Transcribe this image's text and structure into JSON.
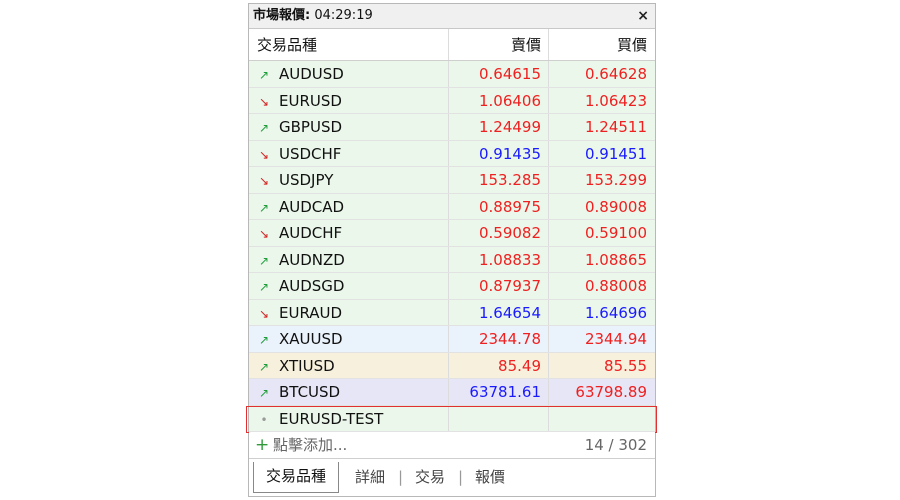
{
  "window": {
    "title_label": "市場報價:",
    "time": "04:29:19",
    "close_glyph": "×"
  },
  "columns": {
    "symbol": "交易品種",
    "bid": "賣價",
    "ask": "買價"
  },
  "rows": [
    {
      "symbol": "AUDUSD",
      "bid": "0.64615",
      "ask": "0.64628",
      "dir": "up",
      "arrow": "↗",
      "bg": "#eaf7ea",
      "bid_color": "red",
      "ask_color": "red"
    },
    {
      "symbol": "EURUSD",
      "bid": "1.06406",
      "ask": "1.06423",
      "dir": "down",
      "arrow": "↘",
      "bg": "#eaf7ea",
      "bid_color": "red",
      "ask_color": "red"
    },
    {
      "symbol": "GBPUSD",
      "bid": "1.24499",
      "ask": "1.24511",
      "dir": "up",
      "arrow": "↗",
      "bg": "#eaf7ea",
      "bid_color": "red",
      "ask_color": "red"
    },
    {
      "symbol": "USDCHF",
      "bid": "0.91435",
      "ask": "0.91451",
      "dir": "down",
      "arrow": "↘",
      "bg": "#eaf7ea",
      "bid_color": "blue",
      "ask_color": "blue"
    },
    {
      "symbol": "USDJPY",
      "bid": "153.285",
      "ask": "153.299",
      "dir": "down",
      "arrow": "↘",
      "bg": "#eaf7ea",
      "bid_color": "red",
      "ask_color": "red"
    },
    {
      "symbol": "AUDCAD",
      "bid": "0.88975",
      "ask": "0.89008",
      "dir": "up",
      "arrow": "↗",
      "bg": "#eaf7ea",
      "bid_color": "red",
      "ask_color": "red"
    },
    {
      "symbol": "AUDCHF",
      "bid": "0.59082",
      "ask": "0.59100",
      "dir": "down",
      "arrow": "↘",
      "bg": "#eaf7ea",
      "bid_color": "red",
      "ask_color": "red"
    },
    {
      "symbol": "AUDNZD",
      "bid": "1.08833",
      "ask": "1.08865",
      "dir": "up",
      "arrow": "↗",
      "bg": "#eaf7ea",
      "bid_color": "red",
      "ask_color": "red"
    },
    {
      "symbol": "AUDSGD",
      "bid": "0.87937",
      "ask": "0.88008",
      "dir": "up",
      "arrow": "↗",
      "bg": "#eaf7ea",
      "bid_color": "red",
      "ask_color": "red"
    },
    {
      "symbol": "EURAUD",
      "bid": "1.64654",
      "ask": "1.64696",
      "dir": "down",
      "arrow": "↘",
      "bg": "#eaf7ea",
      "bid_color": "blue",
      "ask_color": "blue"
    },
    {
      "symbol": "XAUUSD",
      "bid": "2344.78",
      "ask": "2344.94",
      "dir": "up",
      "arrow": "↗",
      "bg": "#eaf2fb",
      "bid_color": "red",
      "ask_color": "red"
    },
    {
      "symbol": "XTIUSD",
      "bid": "85.49",
      "ask": "85.55",
      "dir": "up",
      "arrow": "↗",
      "bg": "#f6f0dc",
      "bid_color": "red",
      "ask_color": "red"
    },
    {
      "symbol": "BTCUSD",
      "bid": "63781.61",
      "ask": "63798.89",
      "dir": "up",
      "arrow": "↗",
      "bg": "#e6e6f6",
      "bid_color": "blue",
      "ask_color": "red"
    },
    {
      "symbol": "EURUSD-TEST",
      "bid": "",
      "ask": "",
      "dir": "dot",
      "arrow": "•",
      "bg": "#eaf7ea",
      "bid_color": "red",
      "ask_color": "red",
      "selected": true
    }
  ],
  "add": {
    "plus": "+",
    "label": "點擊添加...",
    "count": "14 / 302"
  },
  "tabs": {
    "symbols": "交易品種",
    "details": "詳細",
    "trading": "交易",
    "ticks": "報價",
    "separator": "|"
  },
  "colors": {
    "up_arrow": "#1e9e3a",
    "down_arrow": "#d81e1e",
    "price_red": "#ef2020",
    "price_blue": "#1a1aff",
    "selection_border": "#e03030"
  }
}
